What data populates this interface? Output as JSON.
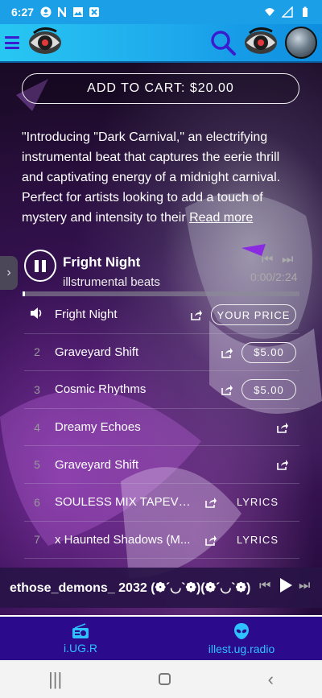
{
  "status_bar": {
    "time": "6:27",
    "icons": [
      "account-circle-icon",
      "n-icon",
      "image-icon",
      "x-box-icon"
    ],
    "right_icons": [
      "wifi-icon",
      "signal-icon",
      "battery-icon"
    ]
  },
  "header": {
    "menu_icon": "hamburger-menu-icon",
    "logo": "eye-logo-icon",
    "search_icon": "search-icon",
    "avatar": "user-avatar"
  },
  "product": {
    "add_to_cart_label": "ADD TO CART: $20.00",
    "description": "\"Introducing \"Dark Carnival,\" an electrifying instrumental beat that captures the eerie thrill and captivating energy of a midnight carnival. Perfect for artists looking to add a touch of mystery and intensity to their ",
    "read_more": "Read more"
  },
  "now_playing": {
    "title": "Fright Night",
    "artist": "illstrumental beats",
    "time": "0:00/2:24",
    "progress_fraction": 0.0
  },
  "tracks": [
    {
      "num": "",
      "title": "Fright Night",
      "action": "YOUR PRICE",
      "type": "price"
    },
    {
      "num": "2",
      "title": "Graveyard Shift",
      "action": "$5.00",
      "type": "price"
    },
    {
      "num": "3",
      "title": "Cosmic Rhythms",
      "action": "$5.00",
      "type": "price"
    },
    {
      "num": "4",
      "title": "Dreamy Echoes",
      "action": "",
      "type": "none"
    },
    {
      "num": "5",
      "title": "Graveyard Shift",
      "action": "",
      "type": "none"
    },
    {
      "num": "6",
      "title": "SOULESS MIX TAPEVOL...",
      "action": "LYRICS",
      "type": "lyrics"
    },
    {
      "num": "7",
      "title": "x Haunted Shadows (M...",
      "action": "LYRICS",
      "type": "lyrics"
    }
  ],
  "mini_player": {
    "title": "ethose_demons_ 2032 (❁´◡`❁)(❁´◡`❁)"
  },
  "bottom_nav": [
    {
      "label": "i.UG.R",
      "icon": "radio-icon"
    },
    {
      "label": "illest.ug.radio",
      "icon": "alien-icon"
    }
  ],
  "colors": {
    "status_bar": "#1ba0e8",
    "header": "#28c7f2",
    "bottom_nav_bg": "#2c0a8c",
    "bottom_nav_text": "#2ec0ff",
    "accent_purple": "#3a1ccf"
  }
}
